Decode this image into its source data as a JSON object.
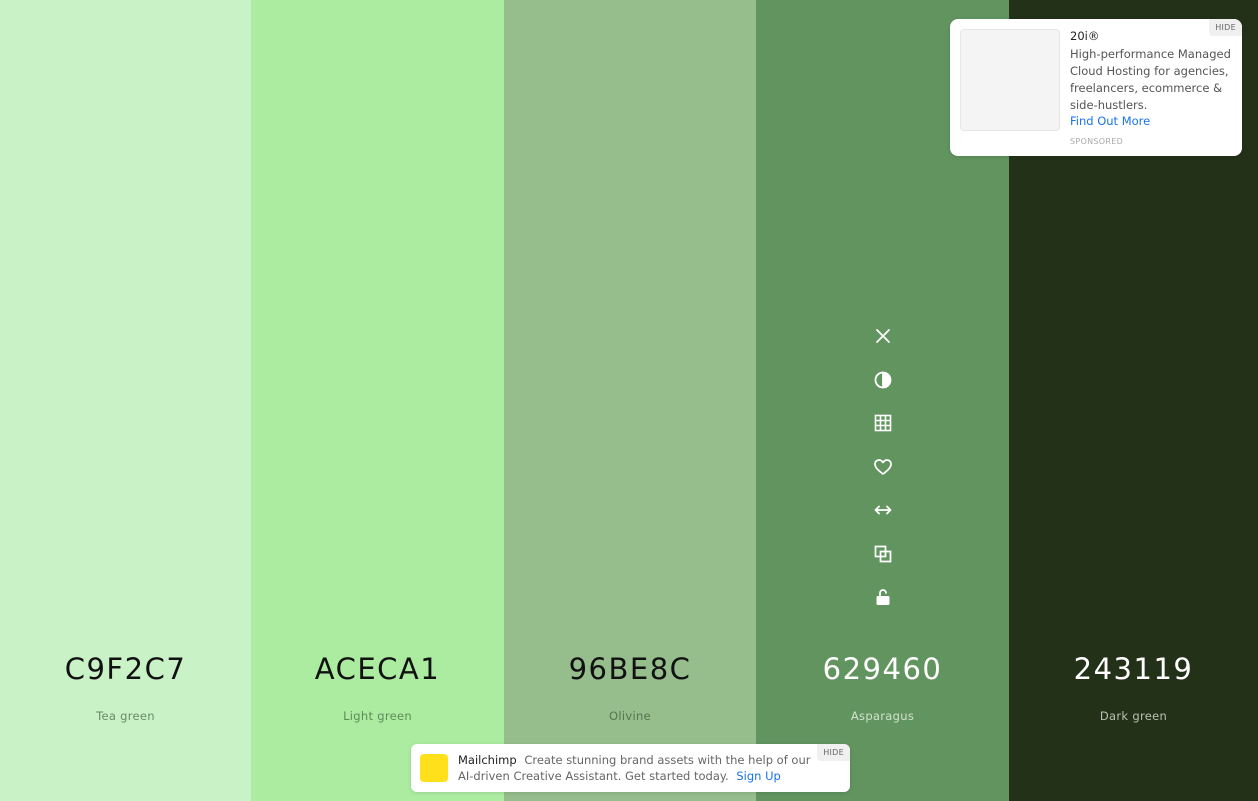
{
  "palette": [
    {
      "hex": "C9F2C7",
      "name": "Tea green",
      "bg": "#C9F2C7",
      "hex_color": "#111111",
      "name_color": "#6b8a69"
    },
    {
      "hex": "ACECA1",
      "name": "Light green",
      "bg": "#ACECA1",
      "hex_color": "#111111",
      "name_color": "#5f8a58"
    },
    {
      "hex": "96BE8C",
      "name": "Olivine",
      "bg": "#96BE8C",
      "hex_color": "#111111",
      "name_color": "#56734f"
    },
    {
      "hex": "629460",
      "name": "Asparagus",
      "bg": "#629460",
      "hex_color": "#ffffff",
      "name_color": "#d0e2cf"
    },
    {
      "hex": "243119",
      "name": "Dark green",
      "bg": "#243119",
      "hex_color": "#ffffff",
      "name_color": "#b9c0b3"
    }
  ],
  "toolbar": {
    "icons": [
      "close-icon",
      "contrast-icon",
      "grid-icon",
      "heart-icon",
      "arrows-horizontal-icon",
      "copy-icon",
      "lock-open-icon"
    ],
    "color": "#ffffff"
  },
  "ad_card": {
    "brand": "20i®",
    "description": "High-performance Managed Cloud Hosting for agencies, freelancers, ecommerce & side-hustlers.",
    "cta": "Find Out More",
    "sponsored": "SPONSORED",
    "hide": "HIDE"
  },
  "ad_bar": {
    "brand": "Mailchimp",
    "description": "Create stunning brand assets with the help of our AI-driven Creative Assistant. Get started today.",
    "cta": "Sign Up",
    "hide": "HIDE"
  }
}
